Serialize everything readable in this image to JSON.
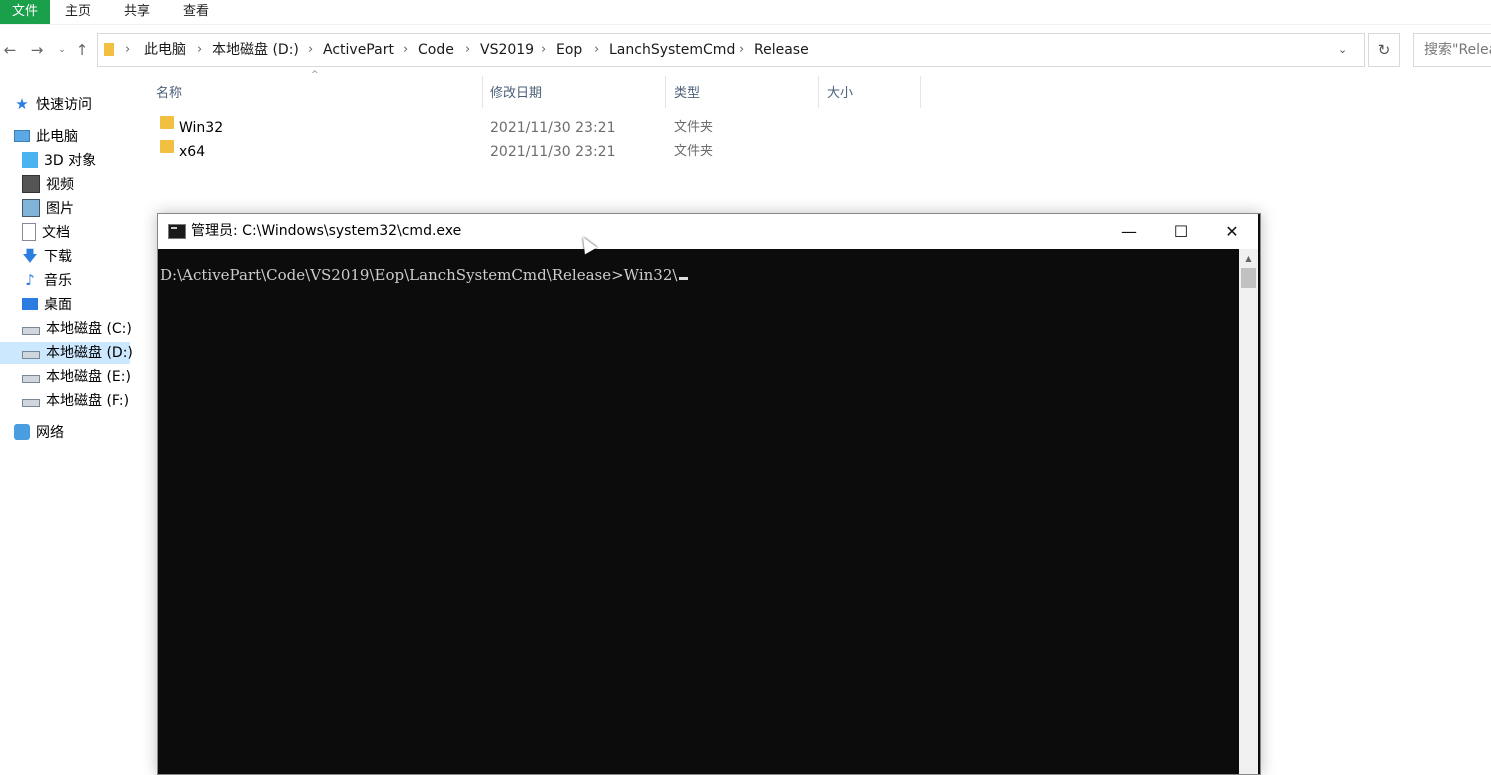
{
  "ribbon": {
    "tabs": [
      {
        "label": "文件"
      },
      {
        "label": "主页"
      },
      {
        "label": "共享"
      },
      {
        "label": "查看"
      }
    ]
  },
  "address": {
    "crumbs": [
      "此电脑",
      "本地磁盘 (D:)",
      "ActivePart",
      "Code",
      "VS2019",
      "Eop",
      "LanchSystemCmd",
      "Release"
    ],
    "separator": "›"
  },
  "search": {
    "placeholder": "搜索\"Release\""
  },
  "nav": {
    "items": [
      {
        "label": "快速访问",
        "icon": "star-icon"
      },
      {
        "label": "此电脑",
        "icon": "computer-icon"
      },
      {
        "label": "3D 对象",
        "icon": "3d-objects-icon"
      },
      {
        "label": "视频",
        "icon": "video-icon"
      },
      {
        "label": "图片",
        "icon": "pictures-icon"
      },
      {
        "label": "文档",
        "icon": "documents-icon"
      },
      {
        "label": "下载",
        "icon": "download-icon"
      },
      {
        "label": "音乐",
        "icon": "music-icon"
      },
      {
        "label": "桌面",
        "icon": "desktop-icon"
      },
      {
        "label": "本地磁盘 (C:)",
        "icon": "drive-icon"
      },
      {
        "label": "本地磁盘 (D:)",
        "icon": "drive-icon",
        "selected": true
      },
      {
        "label": "本地磁盘 (E:)",
        "icon": "drive-icon"
      },
      {
        "label": "本地磁盘 (F:)",
        "icon": "drive-icon"
      },
      {
        "label": "网络",
        "icon": "network-icon"
      }
    ]
  },
  "columns": {
    "name": "名称",
    "modified": "修改日期",
    "type": "类型",
    "size": "大小"
  },
  "files": [
    {
      "name": "Win32",
      "modified": "2021/11/30 23:21",
      "type": "文件夹"
    },
    {
      "name": "x64",
      "modified": "2021/11/30 23:21",
      "type": "文件夹"
    }
  ],
  "cmd": {
    "title": "管理员: C:\\Windows\\system32\\cmd.exe",
    "minimize": "—",
    "maximize": "☐",
    "close": "✕",
    "line": "D:\\ActivePart\\Code\\VS2019\\Eop\\LanchSystemCmd\\Release>Win32\\"
  },
  "colors": {
    "file_tab": "#1a9f4a",
    "console_bg": "#0c0c0c",
    "console_text": "#cccccc",
    "selected": "#cce8ff"
  }
}
